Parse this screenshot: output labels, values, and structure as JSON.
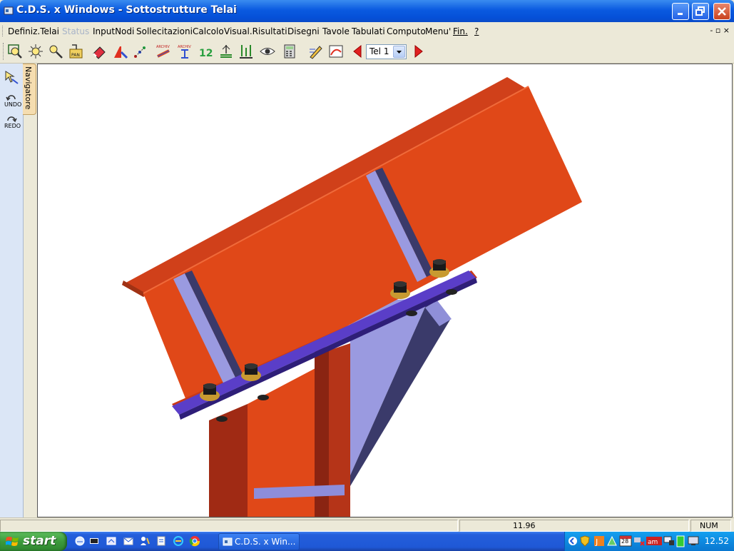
{
  "window": {
    "title": "C.D.S. x Windows - Sottostrutture Telai"
  },
  "menu": {
    "items": [
      {
        "label": "Definiz.Telai",
        "disabled": false
      },
      {
        "label": "Status",
        "disabled": true
      },
      {
        "label": "InputNodi",
        "disabled": false
      },
      {
        "label": "Sollecitazioni",
        "disabled": false
      },
      {
        "label": "Calcolo",
        "disabled": false
      },
      {
        "label": "Visual.Risultati",
        "disabled": false
      },
      {
        "label": "Disegni",
        "disabled": false
      },
      {
        "label": "Tavole",
        "disabled": false
      },
      {
        "label": "Tabulati",
        "disabled": false
      },
      {
        "label": "Computo",
        "disabled": false
      },
      {
        "label": "Menu'",
        "disabled": false
      },
      {
        "label": "Fin.",
        "disabled": false
      },
      {
        "label": "?",
        "disabled": false
      }
    ],
    "mdi_controls": "- ▫ ×"
  },
  "toolbar": {
    "telaio_select": {
      "value": "Tel 1"
    }
  },
  "sidebar": {
    "navigator_tab": "Navigatore",
    "undo_label": "UNDO",
    "redo_label": "REDO"
  },
  "statusbar": {
    "value": "11.96",
    "num": "NUM"
  },
  "taskbar": {
    "start_label": "start",
    "task_label": "C.D.S. x Win...",
    "clock": "12.52",
    "tray_calendar": "28"
  },
  "colors": {
    "beam": "#e04818",
    "plate": "#5a3ec8",
    "stiffener": "#9a9ae0"
  }
}
